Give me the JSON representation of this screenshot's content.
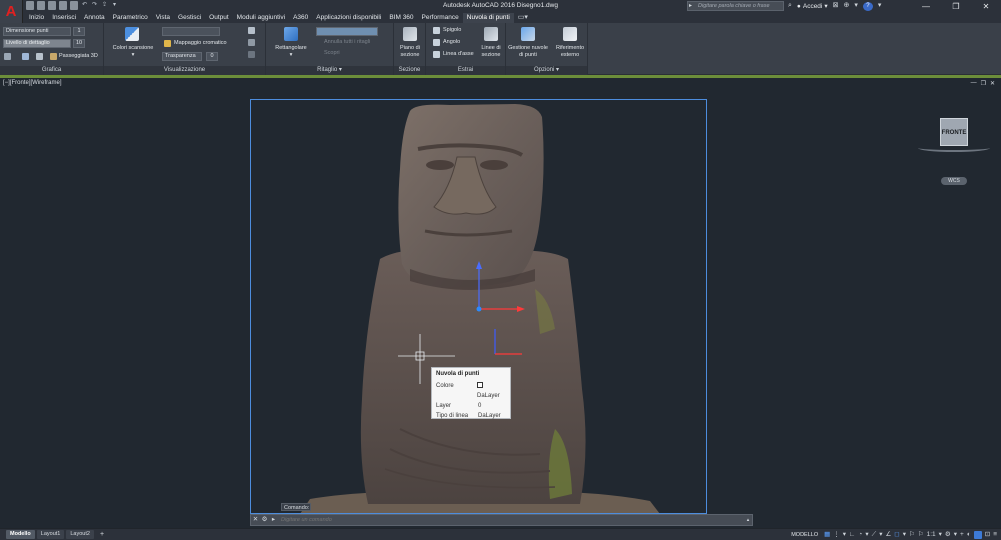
{
  "app": {
    "title": "Autodesk AutoCAD 2016    Disegno1.dwg",
    "logo_letter": "A"
  },
  "search": {
    "placeholder": "Digitare parola chiave o frase"
  },
  "account": {
    "label": "Accedi"
  },
  "help": "?",
  "window_controls": [
    "—",
    "❐",
    "✕"
  ],
  "tabs": [
    "Inizio",
    "Inserisci",
    "Annota",
    "Parametrico",
    "Vista",
    "Gestisci",
    "Output",
    "Moduli aggiuntivi",
    "A360",
    "Applicazioni disponibili",
    "BIM 360",
    "Performance",
    "Nuvola di punti"
  ],
  "active_tab": "Nuvola di punti",
  "ribbon": {
    "grafica": {
      "title": "Grafica",
      "dim_label": "Dimensione punti",
      "dim_value": "1",
      "detail_label": "Livello di dettaglio",
      "detail_value": "10",
      "walk_label": "Passeggiata 3D"
    },
    "visualizzazione": {
      "title": "Visualizzazione",
      "colors_label": "Colori scansione",
      "mapping_label": "Mappaggio cromatico",
      "transparency_label": "Trasparenza",
      "transparency_value": "0"
    },
    "ritaglio": {
      "title": "Ritaglio",
      "rect_label": "Rettangolare",
      "invert_label": "Annulla tutti i ritagli",
      "hide_label": "Scopri"
    },
    "sezione": {
      "title": "Sezione",
      "plane_label": "Piano di sezione"
    },
    "estrai": {
      "title": "Estrai",
      "edge_label": "Spigolo",
      "corner_label": "Angolo",
      "axis_label": "Linea d'asse",
      "section_lines_label": "Linee di sezione"
    },
    "opzioni": {
      "title": "Opzioni",
      "manage_label": "Gestione nuvole di punti",
      "xref_label": "Riferimento esterno"
    }
  },
  "viewport": {
    "label": "[−][Fronte][Wireframe]",
    "controls": [
      "—",
      "❐",
      "✕"
    ],
    "viewcube_label": "FRONTE",
    "wcs_label": "WCS"
  },
  "tooltip": {
    "title": "Nuvola di punti",
    "rows": [
      {
        "key": "Colore",
        "value": "DaLayer"
      },
      {
        "key": "Layer",
        "value": "0"
      },
      {
        "key": "Tipo di linea",
        "value": "DaLayer"
      }
    ]
  },
  "command": {
    "history_label": "Comando:",
    "placeholder": "Digitare un comando"
  },
  "status": {
    "layout_tabs": [
      "Modello",
      "Layout1",
      "Layout2"
    ],
    "active_layout": "Modello",
    "model_label": "MODELLO",
    "scale_label": "1:1"
  }
}
